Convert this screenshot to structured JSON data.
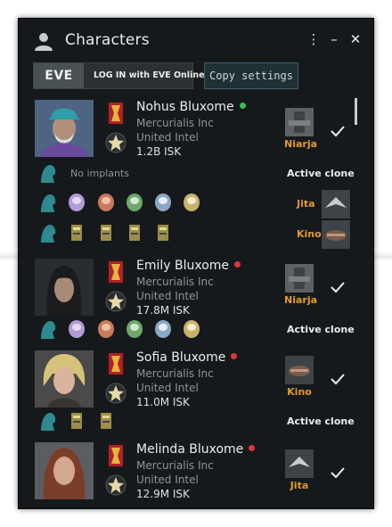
{
  "window": {
    "title": "Characters",
    "controls": {
      "menu": "⋮",
      "minimize": "–",
      "close": "✕"
    }
  },
  "toolbar": {
    "eve_logo_text": "EVE",
    "login_label": "LOG IN with EVE Online",
    "copy_settings_label": "Copy settings"
  },
  "colors": {
    "online": "#36c04a",
    "offline": "#e2333a",
    "location": "#e39a2a",
    "window_bg": "#15191b"
  },
  "characters": [
    {
      "name": "Nohus Bluxome",
      "status": "online",
      "corporation": "Mercurialis Inc",
      "alliance": "United Intel",
      "isk": "1.2B ISK",
      "location": "Niarja"
    },
    {
      "name": "Emily Bluxome",
      "status": "offline",
      "corporation": "Mercurialis Inc",
      "alliance": "United Intel",
      "isk": "17.8M ISK",
      "location": "Niarja"
    },
    {
      "name": "Sofia Bluxome",
      "status": "offline",
      "corporation": "Mercurialis Inc",
      "alliance": "United Intel",
      "isk": "11.0M ISK",
      "location": "Kino"
    },
    {
      "name": "Melinda Bluxome",
      "status": "offline",
      "corporation": "Mercurialis Inc",
      "alliance": "United Intel",
      "isk": "12.9M ISK",
      "location": "Jita"
    }
  ],
  "clones": {
    "no_implants": "No implants",
    "active_clone_label": "Active clone",
    "jump_clones": [
      "Jita",
      "Kino"
    ]
  }
}
